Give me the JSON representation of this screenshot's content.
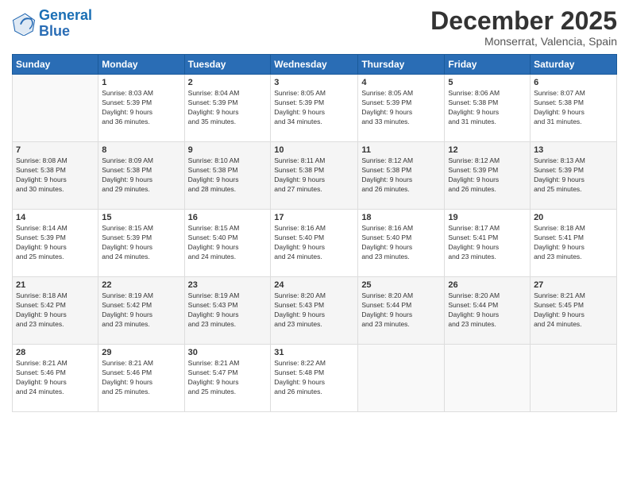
{
  "logo": {
    "line1": "General",
    "line2": "Blue"
  },
  "header": {
    "month": "December 2025",
    "location": "Monserrat, Valencia, Spain"
  },
  "days_of_week": [
    "Sunday",
    "Monday",
    "Tuesday",
    "Wednesday",
    "Thursday",
    "Friday",
    "Saturday"
  ],
  "weeks": [
    [
      {
        "day": "",
        "sunrise": "",
        "sunset": "",
        "daylight": ""
      },
      {
        "day": "1",
        "sunrise": "Sunrise: 8:03 AM",
        "sunset": "Sunset: 5:39 PM",
        "daylight": "Daylight: 9 hours and 36 minutes."
      },
      {
        "day": "2",
        "sunrise": "Sunrise: 8:04 AM",
        "sunset": "Sunset: 5:39 PM",
        "daylight": "Daylight: 9 hours and 35 minutes."
      },
      {
        "day": "3",
        "sunrise": "Sunrise: 8:05 AM",
        "sunset": "Sunset: 5:39 PM",
        "daylight": "Daylight: 9 hours and 34 minutes."
      },
      {
        "day": "4",
        "sunrise": "Sunrise: 8:05 AM",
        "sunset": "Sunset: 5:39 PM",
        "daylight": "Daylight: 9 hours and 33 minutes."
      },
      {
        "day": "5",
        "sunrise": "Sunrise: 8:06 AM",
        "sunset": "Sunset: 5:38 PM",
        "daylight": "Daylight: 9 hours and 31 minutes."
      },
      {
        "day": "6",
        "sunrise": "Sunrise: 8:07 AM",
        "sunset": "Sunset: 5:38 PM",
        "daylight": "Daylight: 9 hours and 31 minutes."
      }
    ],
    [
      {
        "day": "7",
        "sunrise": "Sunrise: 8:08 AM",
        "sunset": "Sunset: 5:38 PM",
        "daylight": "Daylight: 9 hours and 30 minutes."
      },
      {
        "day": "8",
        "sunrise": "Sunrise: 8:09 AM",
        "sunset": "Sunset: 5:38 PM",
        "daylight": "Daylight: 9 hours and 29 minutes."
      },
      {
        "day": "9",
        "sunrise": "Sunrise: 8:10 AM",
        "sunset": "Sunset: 5:38 PM",
        "daylight": "Daylight: 9 hours and 28 minutes."
      },
      {
        "day": "10",
        "sunrise": "Sunrise: 8:11 AM",
        "sunset": "Sunset: 5:38 PM",
        "daylight": "Daylight: 9 hours and 27 minutes."
      },
      {
        "day": "11",
        "sunrise": "Sunrise: 8:12 AM",
        "sunset": "Sunset: 5:38 PM",
        "daylight": "Daylight: 9 hours and 26 minutes."
      },
      {
        "day": "12",
        "sunrise": "Sunrise: 8:12 AM",
        "sunset": "Sunset: 5:39 PM",
        "daylight": "Daylight: 9 hours and 26 minutes."
      },
      {
        "day": "13",
        "sunrise": "Sunrise: 8:13 AM",
        "sunset": "Sunset: 5:39 PM",
        "daylight": "Daylight: 9 hours and 25 minutes."
      }
    ],
    [
      {
        "day": "14",
        "sunrise": "Sunrise: 8:14 AM",
        "sunset": "Sunset: 5:39 PM",
        "daylight": "Daylight: 9 hours and 25 minutes."
      },
      {
        "day": "15",
        "sunrise": "Sunrise: 8:15 AM",
        "sunset": "Sunset: 5:39 PM",
        "daylight": "Daylight: 9 hours and 24 minutes."
      },
      {
        "day": "16",
        "sunrise": "Sunrise: 8:15 AM",
        "sunset": "Sunset: 5:40 PM",
        "daylight": "Daylight: 9 hours and 24 minutes."
      },
      {
        "day": "17",
        "sunrise": "Sunrise: 8:16 AM",
        "sunset": "Sunset: 5:40 PM",
        "daylight": "Daylight: 9 hours and 24 minutes."
      },
      {
        "day": "18",
        "sunrise": "Sunrise: 8:16 AM",
        "sunset": "Sunset: 5:40 PM",
        "daylight": "Daylight: 9 hours and 23 minutes."
      },
      {
        "day": "19",
        "sunrise": "Sunrise: 8:17 AM",
        "sunset": "Sunset: 5:41 PM",
        "daylight": "Daylight: 9 hours and 23 minutes."
      },
      {
        "day": "20",
        "sunrise": "Sunrise: 8:18 AM",
        "sunset": "Sunset: 5:41 PM",
        "daylight": "Daylight: 9 hours and 23 minutes."
      }
    ],
    [
      {
        "day": "21",
        "sunrise": "Sunrise: 8:18 AM",
        "sunset": "Sunset: 5:42 PM",
        "daylight": "Daylight: 9 hours and 23 minutes."
      },
      {
        "day": "22",
        "sunrise": "Sunrise: 8:19 AM",
        "sunset": "Sunset: 5:42 PM",
        "daylight": "Daylight: 9 hours and 23 minutes."
      },
      {
        "day": "23",
        "sunrise": "Sunrise: 8:19 AM",
        "sunset": "Sunset: 5:43 PM",
        "daylight": "Daylight: 9 hours and 23 minutes."
      },
      {
        "day": "24",
        "sunrise": "Sunrise: 8:20 AM",
        "sunset": "Sunset: 5:43 PM",
        "daylight": "Daylight: 9 hours and 23 minutes."
      },
      {
        "day": "25",
        "sunrise": "Sunrise: 8:20 AM",
        "sunset": "Sunset: 5:44 PM",
        "daylight": "Daylight: 9 hours and 23 minutes."
      },
      {
        "day": "26",
        "sunrise": "Sunrise: 8:20 AM",
        "sunset": "Sunset: 5:44 PM",
        "daylight": "Daylight: 9 hours and 23 minutes."
      },
      {
        "day": "27",
        "sunrise": "Sunrise: 8:21 AM",
        "sunset": "Sunset: 5:45 PM",
        "daylight": "Daylight: 9 hours and 24 minutes."
      }
    ],
    [
      {
        "day": "28",
        "sunrise": "Sunrise: 8:21 AM",
        "sunset": "Sunset: 5:46 PM",
        "daylight": "Daylight: 9 hours and 24 minutes."
      },
      {
        "day": "29",
        "sunrise": "Sunrise: 8:21 AM",
        "sunset": "Sunset: 5:46 PM",
        "daylight": "Daylight: 9 hours and 25 minutes."
      },
      {
        "day": "30",
        "sunrise": "Sunrise: 8:21 AM",
        "sunset": "Sunset: 5:47 PM",
        "daylight": "Daylight: 9 hours and 25 minutes."
      },
      {
        "day": "31",
        "sunrise": "Sunrise: 8:22 AM",
        "sunset": "Sunset: 5:48 PM",
        "daylight": "Daylight: 9 hours and 26 minutes."
      },
      {
        "day": "",
        "sunrise": "",
        "sunset": "",
        "daylight": ""
      },
      {
        "day": "",
        "sunrise": "",
        "sunset": "",
        "daylight": ""
      },
      {
        "day": "",
        "sunrise": "",
        "sunset": "",
        "daylight": ""
      }
    ]
  ]
}
